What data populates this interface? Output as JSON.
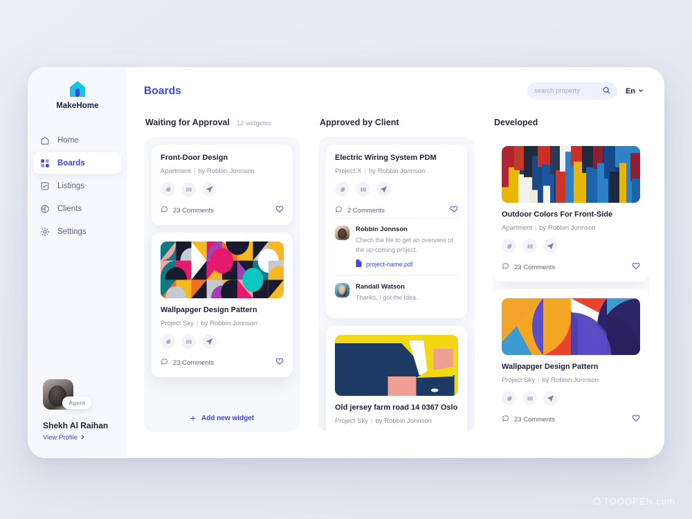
{
  "brand": {
    "name": "MakeHome",
    "logo_icon": "house-icon",
    "accent": "#3b47e0",
    "logo_color": "#19c3e6"
  },
  "sidebar": {
    "items": [
      {
        "label": "Home",
        "icon": "home-icon",
        "active": false
      },
      {
        "label": "Boards",
        "icon": "grid-icon",
        "active": true
      },
      {
        "label": "Listings",
        "icon": "clipboard-icon",
        "active": false
      },
      {
        "label": "Clients",
        "icon": "pie-icon",
        "active": false
      },
      {
        "label": "Settings",
        "icon": "gear-icon",
        "active": false
      }
    ],
    "profile": {
      "name": "Shekh Al Raihan",
      "badge": "Agent",
      "link": "View Profile",
      "link_icon": "chevron-right-icon",
      "avatar": "avatar"
    }
  },
  "header": {
    "title": "Boards",
    "search": {
      "placeholder": "search property",
      "value": "",
      "icon": "search-icon"
    },
    "language": {
      "label": "En",
      "icon": "chevron-down-icon"
    }
  },
  "columns": [
    {
      "title": "Waiting for Approval",
      "count": "12 widgetss",
      "add_label": "Add new widget",
      "add_icon": "plus-icon",
      "cards": [
        {
          "title": "Front-Door Design",
          "category": "Apartment",
          "author": "by Robbin Jonnson",
          "comments": "23 Comments",
          "comments_icon": "comment-icon",
          "like_icon": "heart-icon",
          "actions": [
            "tag-icon",
            "columns-icon",
            "send-icon"
          ],
          "thumb": null
        },
        {
          "title": "Wallpapger Design Pattern",
          "category": "Project Sky",
          "author": "by Robbin Jonnson",
          "comments": "23 Comments",
          "comments_icon": "comment-icon",
          "like_icon": "heart-icon",
          "actions": [
            "tag-icon",
            "columns-icon",
            "send-icon"
          ],
          "thumb": "bauhaus-pattern"
        }
      ]
    },
    {
      "title": "Approved by Client",
      "count": "",
      "cards": [
        {
          "title": "Electric Wiring System PDM",
          "category": "Project X",
          "author": "by Robbin Jonnson",
          "comments": "2 Comments",
          "comments_icon": "comment-icon",
          "like_icon": "heart-icon",
          "actions": [
            "tag-icon",
            "columns-icon",
            "send-icon"
          ],
          "thumb": null,
          "thread": [
            {
              "name": "Robbin Jonnson",
              "text": "Chech the file to get an overview of the up-coming project.",
              "file": "project-name.pdf",
              "file_icon": "file-icon"
            },
            {
              "name": "Randall Watson",
              "text": "Thanks, I got the Idea.",
              "file": null
            }
          ]
        },
        {
          "title": "Old jersey farm road 14 0367 Oslo",
          "category": "Project Sky",
          "author": "by Robbin Jonnson",
          "comments": "",
          "thumb": "navy-yellow-abstract"
        }
      ]
    },
    {
      "title": "Developed",
      "count": "",
      "cards": [
        {
          "title": "Outdoor Colors For Front-Side",
          "category": "Apartment",
          "author": "by Robbin Jonnson",
          "comments": "23 Comments",
          "comments_icon": "comment-icon",
          "like_icon": "heart-icon",
          "actions": [
            "tag-icon",
            "columns-icon",
            "send-icon"
          ],
          "thumb": "paint-strokes"
        },
        {
          "title": "Wallpapger Design Pattern",
          "category": "Project Sky",
          "author": "by Robbin Jonnson",
          "comments": "23 Comments",
          "comments_icon": "comment-icon",
          "like_icon": "heart-icon",
          "actions": [
            "tag-icon",
            "columns-icon",
            "send-icon"
          ],
          "thumb": "arc-pattern"
        }
      ]
    }
  ],
  "watermark": {
    "text": "TOOOPEN.com",
    "icon": "watermark-icon"
  }
}
